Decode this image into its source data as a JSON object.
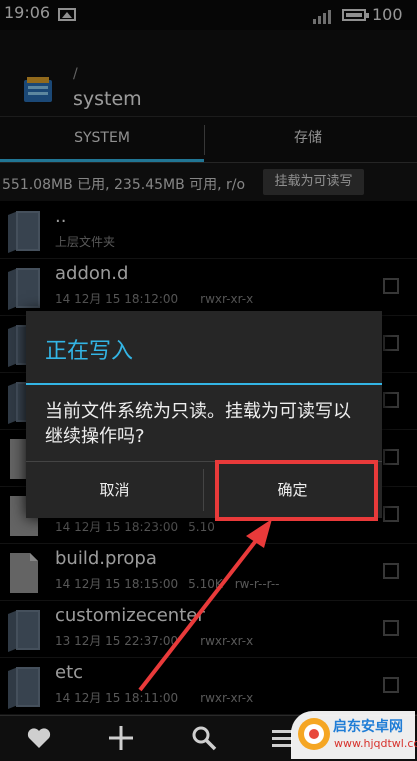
{
  "status_bar": {
    "time": "19:06",
    "battery_pct": "100",
    "battery_level": 1.0
  },
  "header": {
    "path_root": "/",
    "title": "system"
  },
  "tabs": [
    {
      "label": "SYSTEM",
      "active": true
    },
    {
      "label": "存储",
      "active": false
    }
  ],
  "storage_info": {
    "text": "551.08MB 已用, 235.45MB 可用, r/o",
    "mount_button": "挂载为可读写"
  },
  "files": [
    {
      "name": "..",
      "date": "上层文件夹",
      "size": "",
      "perm": "",
      "type": "folder",
      "checkbox": false
    },
    {
      "name": "addon.d",
      "date": "14 12月 15 18:12:00",
      "size": "",
      "perm": "rwxr-xr-x",
      "type": "folder",
      "checkbox": true
    },
    {
      "name": "",
      "date": "",
      "size": "",
      "perm": "",
      "type": "folder",
      "checkbox": true
    },
    {
      "name": "",
      "date": "",
      "size": "",
      "perm": "",
      "type": "folder",
      "checkbox": true
    },
    {
      "name": "",
      "date": "",
      "size": "",
      "perm": "",
      "type": "file",
      "checkbox": true
    },
    {
      "name": "",
      "date": "14 12月 15 18:23:00",
      "size": "5.10",
      "perm": "",
      "type": "file",
      "checkbox": true
    },
    {
      "name": "build.propa",
      "date": "14 12月 15 18:15:00",
      "size": "5.10K",
      "perm": "rw-r--r--",
      "type": "file",
      "checkbox": true
    },
    {
      "name": "customizecenter",
      "date": "13 12月 15 22:37:00",
      "size": "",
      "perm": "rwxr-xr-x",
      "type": "folder",
      "checkbox": true
    },
    {
      "name": "etc",
      "date": "14 12月 15 18:11:00",
      "size": "",
      "perm": "rwxr-xr-x",
      "type": "folder",
      "checkbox": true
    }
  ],
  "dialog": {
    "title": "正在写入",
    "message": "当前文件系统为只读。挂载为可读写以继续操作吗?",
    "cancel_label": "取消",
    "ok_label": "确定"
  },
  "bottom_bar": {
    "icons": [
      "heart-icon",
      "plus-icon",
      "search-icon",
      "menu-icon"
    ]
  },
  "watermark": {
    "name": "启东安卓网",
    "url": "www.hjqdtwl.com"
  },
  "colors": {
    "accent": "#33b5e5",
    "highlight": "#e93a3a",
    "dialog_bg": "#262626"
  }
}
